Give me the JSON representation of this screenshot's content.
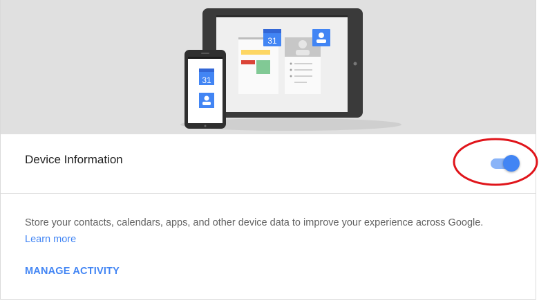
{
  "hero": {
    "calendar_day_tablet": "31",
    "calendar_day_phone": "31"
  },
  "setting": {
    "title": "Device Information",
    "toggle_state": "on",
    "description": "Store your contacts, calendars, apps, and other device data to improve your experience across Google.",
    "learn_more": "Learn more",
    "manage_activity": "MANAGE ACTIVITY"
  },
  "colors": {
    "accent": "#4285f4",
    "toggle_track": "#8ab4f8",
    "highlight": "#e0151b",
    "hero_background": "#e0e0e0"
  }
}
